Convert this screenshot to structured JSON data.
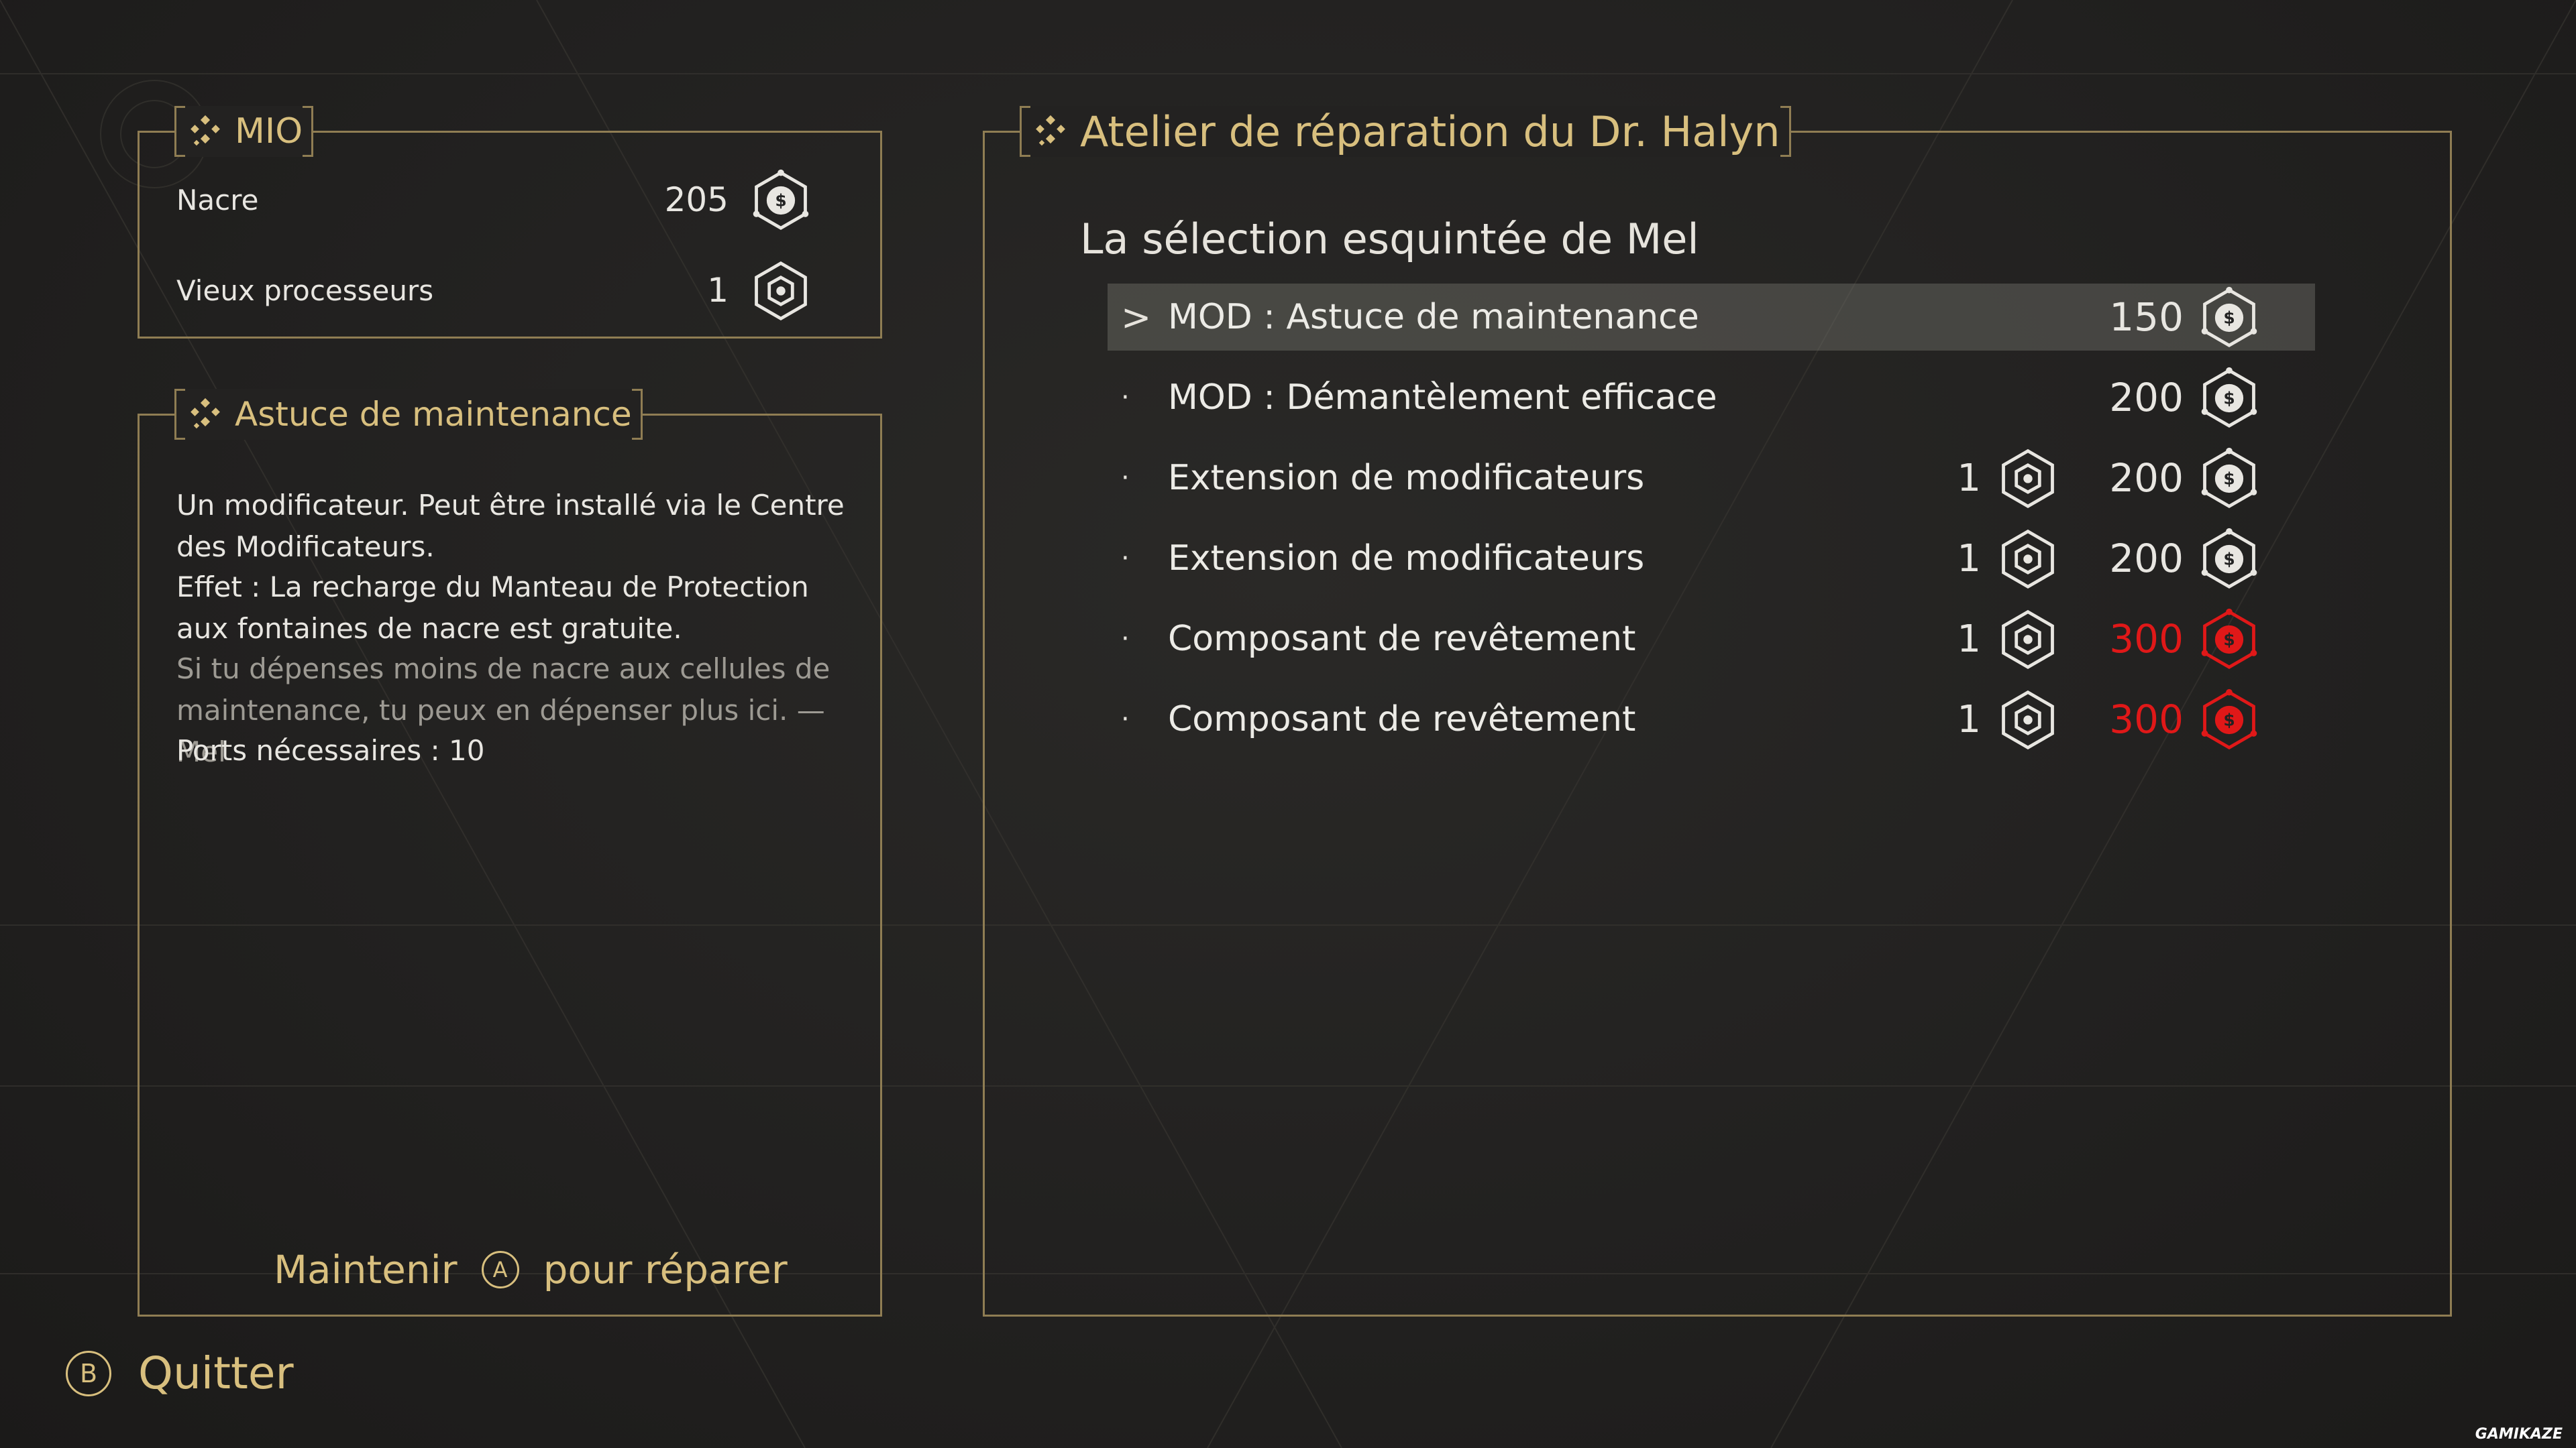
{
  "colors": {
    "gold": "#d8bf7e",
    "border": "#8f7d53",
    "insufficient": "#e01818",
    "selected_bg": "#5a5955"
  },
  "resources_panel": {
    "title": "MIO",
    "items": [
      {
        "label": "Nacre",
        "value": "205",
        "icon": "nacre-icon"
      },
      {
        "label": "Vieux processeurs",
        "value": "1",
        "icon": "processor-icon"
      }
    ]
  },
  "detail_panel": {
    "title": "Astuce de maintenance",
    "description": "Un modificateur. Peut être installé via le Centre des Modificateurs.",
    "effect": "Effet : La recharge du Manteau de Protection aux fontaines de nacre est gratuite.",
    "quote": "Si tu dépenses moins de nacre aux cellules de maintenance, tu peux en dépenser plus ici. — Mel",
    "ports": "Ports nécessaires : 10",
    "hold_prefix": "Maintenir",
    "hold_button": "A",
    "hold_suffix": "pour réparer"
  },
  "shop_panel": {
    "title": "Atelier de réparation du Dr. Halyn",
    "subtitle": "La sélection esquintée de Mel",
    "selected_marker": ">",
    "items": [
      {
        "name": "MOD : Astuce de maintenance",
        "processors": "",
        "price": "150",
        "affordable": true,
        "selected": true
      },
      {
        "name": "MOD : Démantèlement efficace",
        "processors": "",
        "price": "200",
        "affordable": true,
        "selected": false
      },
      {
        "name": "Extension de modificateurs",
        "processors": "1",
        "price": "200",
        "affordable": true,
        "selected": false
      },
      {
        "name": "Extension de modificateurs",
        "processors": "1",
        "price": "200",
        "affordable": true,
        "selected": false
      },
      {
        "name": "Composant de revêtement",
        "processors": "1",
        "price": "300",
        "affordable": false,
        "selected": false
      },
      {
        "name": "Composant de revêtement",
        "processors": "1",
        "price": "300",
        "affordable": false,
        "selected": false
      }
    ]
  },
  "footer": {
    "quit_button": "B",
    "quit_label": "Quitter"
  },
  "watermark": "GAMIKAZE"
}
